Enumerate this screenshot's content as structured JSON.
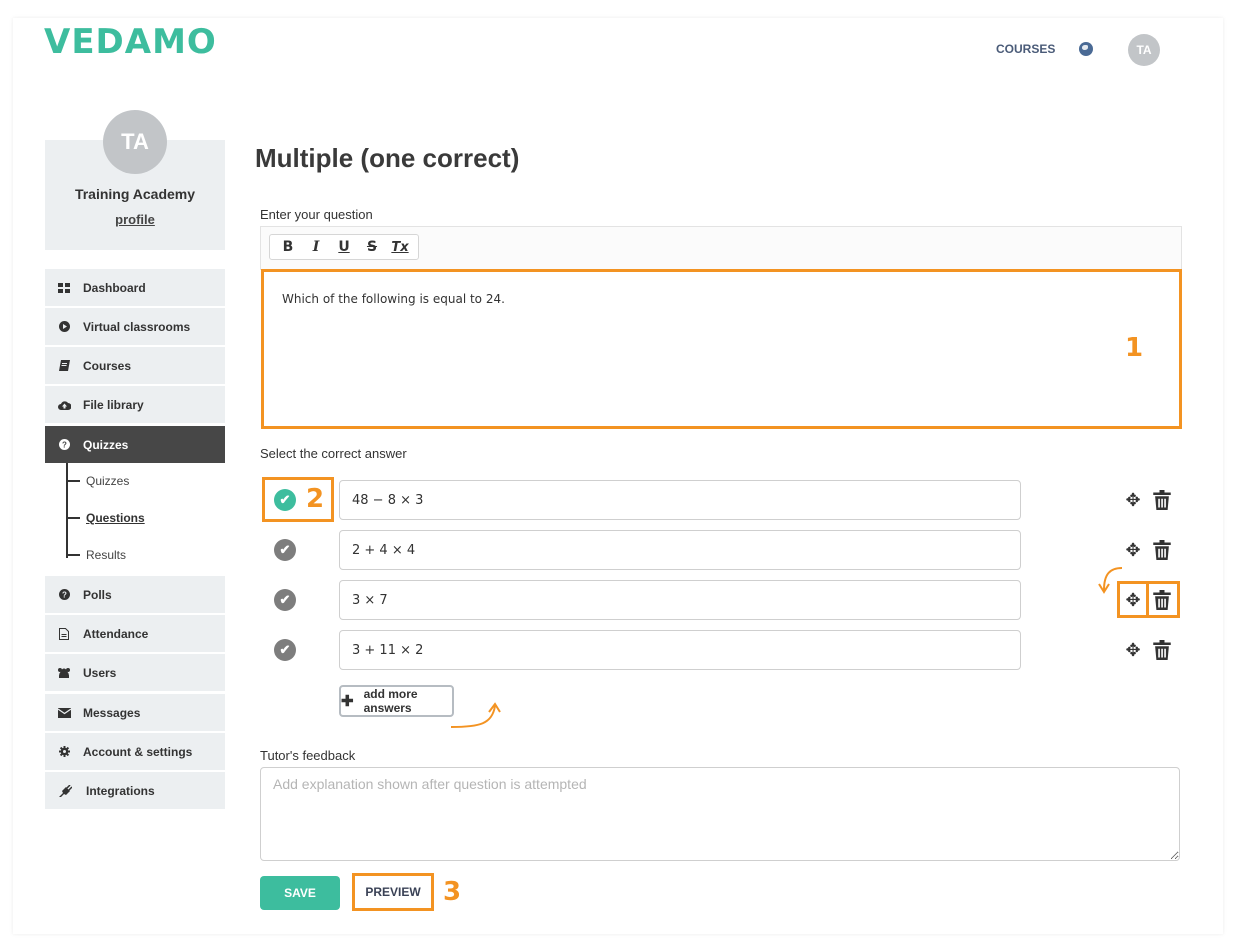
{
  "brand": {
    "logo_text": "VEDAMO",
    "accent_color": "#3dbd9e",
    "highlight_color": "#f39322"
  },
  "topnav": {
    "courses_label": "COURSES",
    "globe_icon": "globe-icon",
    "avatar_initials": "TA"
  },
  "profile": {
    "avatar_initials": "TA",
    "name": "Training Academy",
    "link_label": "profile"
  },
  "sidebar": {
    "items": [
      {
        "label": "Dashboard",
        "icon": "grid-icon"
      },
      {
        "label": "Virtual classrooms",
        "icon": "play-icon"
      },
      {
        "label": "Courses",
        "icon": "book-icon"
      },
      {
        "label": "File library",
        "icon": "cloud-upload-icon"
      },
      {
        "label": "Quizzes",
        "icon": "question-icon",
        "active": true
      },
      {
        "label": "Polls",
        "icon": "question-icon"
      },
      {
        "label": "Attendance",
        "icon": "document-icon"
      },
      {
        "label": "Users",
        "icon": "users-icon"
      },
      {
        "label": "Messages",
        "icon": "envelope-icon"
      },
      {
        "label": "Account & settings",
        "icon": "gear-icon"
      },
      {
        "label": "Integrations",
        "icon": "plug-icon"
      }
    ],
    "quiz_subitems": [
      {
        "label": "Quizzes"
      },
      {
        "label": "Questions",
        "current": true
      },
      {
        "label": "Results"
      }
    ]
  },
  "main": {
    "title": "Multiple (one correct)",
    "question_label": "Enter your question",
    "toolbar": {
      "bold": "B",
      "italic": "I",
      "underline": "U",
      "strike": "S",
      "clear_format": "Tx"
    },
    "question_text": "Which of the following is equal to 24.",
    "answers_label": "Select the correct answer",
    "answers": [
      {
        "value": "48 − 8 × 3",
        "correct": true
      },
      {
        "value": "2 + 4 × 4",
        "correct": false
      },
      {
        "value": "3 × 7",
        "correct": false
      },
      {
        "value": "3 + 11 × 2",
        "correct": false
      }
    ],
    "add_answers_label": "add more answers",
    "feedback_label": "Tutor's feedback",
    "feedback_placeholder": "Add explanation shown after question is attempted",
    "feedback_value": "",
    "save_label": "SAVE",
    "preview_label": "PREVIEW"
  },
  "callouts": {
    "one": "1",
    "two": "2",
    "three": "3"
  }
}
